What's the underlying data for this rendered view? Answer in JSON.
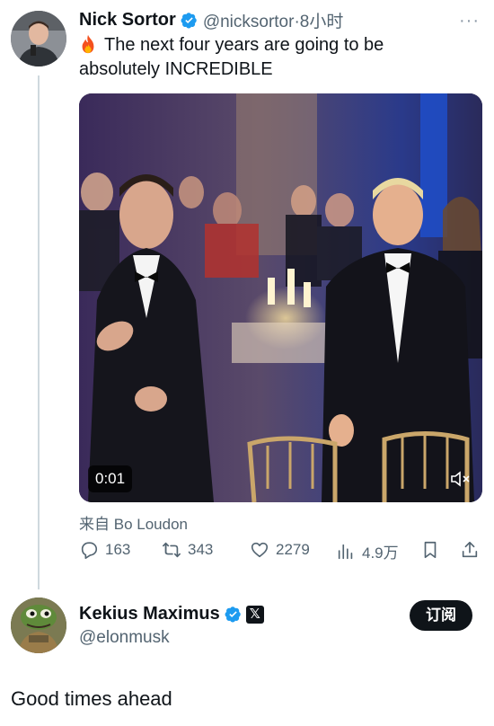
{
  "tweet": {
    "author_name": "Nick Sortor",
    "author_handle": "@nicksortor",
    "separator": "·",
    "time": "8小时",
    "more": "···",
    "text_line1": "The next four years are going to be",
    "text_line2": "absolutely INCREDIBLE",
    "video": {
      "time": "0:01"
    },
    "source_prefix": "来自",
    "source_name": "Bo Loudon",
    "stats": {
      "replies": "163",
      "reposts": "343",
      "likes": "2279",
      "views": "4.9万"
    }
  },
  "user_card": {
    "name": "Kekius Maximus",
    "handle": "@elonmusk",
    "affiliate_badge": "𝕏",
    "subscribe_label": "订阅"
  },
  "reply": {
    "text": "Good times ahead"
  },
  "colors": {
    "text": "#0f1419",
    "secondary": "#536471",
    "verified": "#1d9bf0",
    "button": "#0f1419"
  }
}
